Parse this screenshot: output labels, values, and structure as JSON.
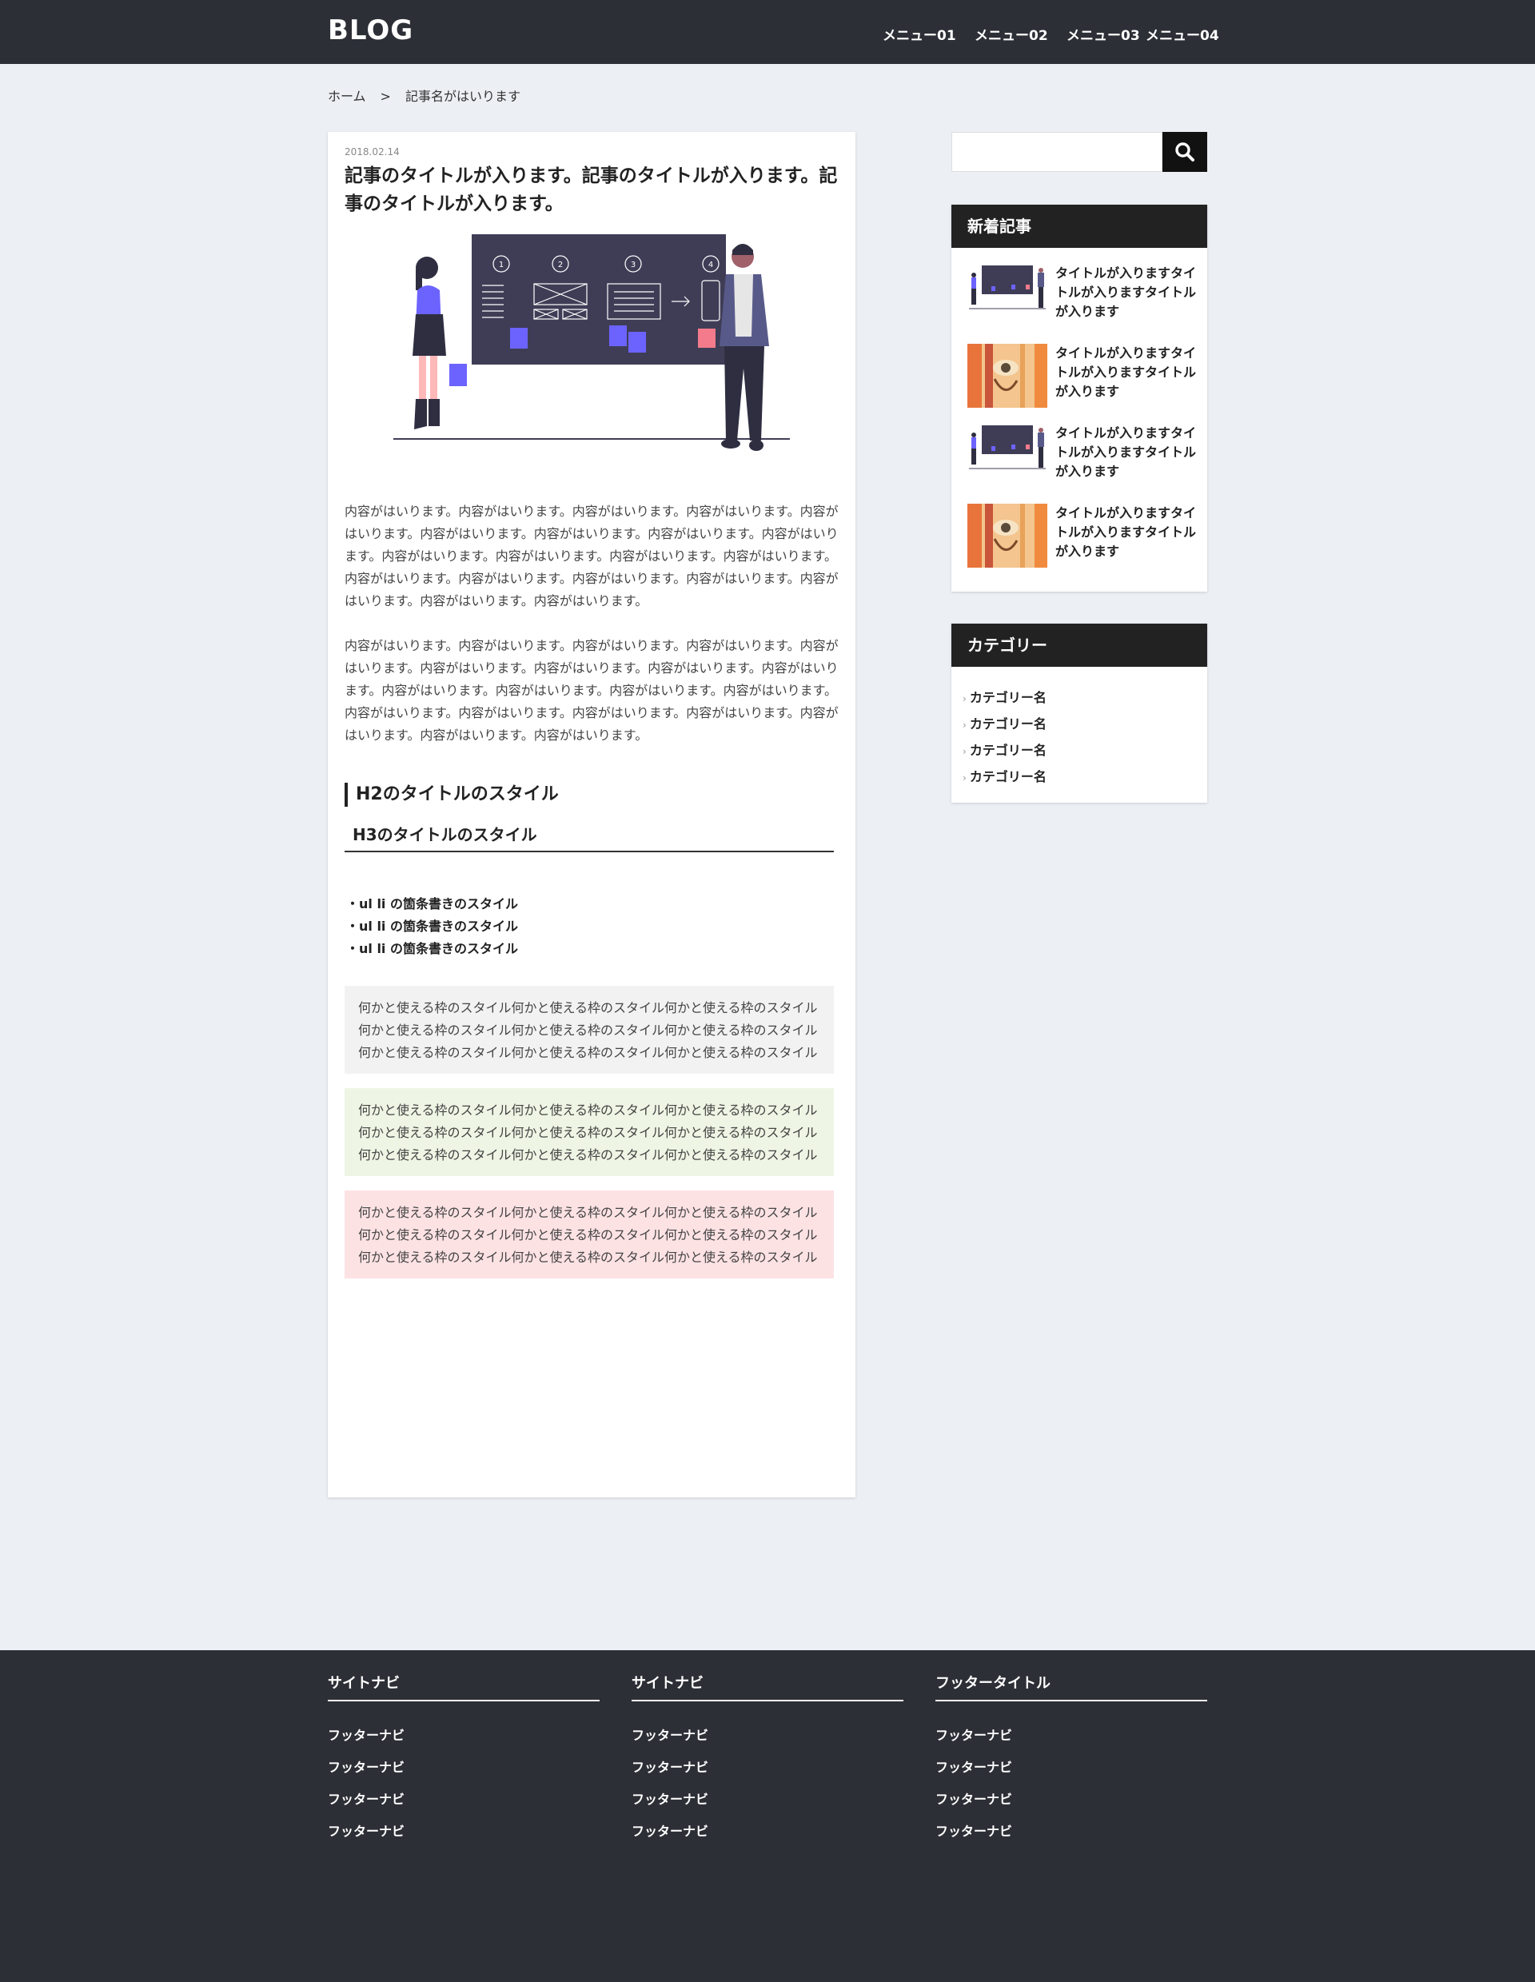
{
  "header": {
    "logo": "BLOG",
    "menu": [
      "メニュー01",
      "メニュー02",
      "メニュー03",
      "メニュー04"
    ]
  },
  "breadcrumb": {
    "home": "ホーム",
    "separator": ">",
    "current": "記事名がはいります"
  },
  "article": {
    "date": "2018.02.14",
    "title": "記事のタイトルが入ります。記事のタイトルが入ります。記事のタイトルが入ります。",
    "paragraphs": [
      "内容がはいります。内容がはいります。内容がはいります。内容がはいります。内容がはいります。内容がはいります。内容がはいります。内容がはいります。内容がはいります。内容がはいります。内容がはいります。内容がはいります。内容がはいります。内容がはいります。内容がはいります。内容がはいります。内容がはいります。内容がはいります。内容がはいります。内容がはいります。",
      "内容がはいります。内容がはいります。内容がはいります。内容がはいります。内容がはいります。内容がはいります。内容がはいります。内容がはいります。内容がはいります。内容がはいります。内容がはいります。内容がはいります。内容がはいります。内容がはいります。内容がはいります。内容がはいります。内容がはいります。内容がはいります。内容がはいります。内容がはいります。"
    ],
    "h2": "H2のタイトルのスタイル",
    "h3": "H3のタイトルのスタイル",
    "list": [
      "・ul li の箇条書きのスタイル",
      "・ul li の箇条書きのスタイル",
      "・ul li の箇条書きのスタイル"
    ],
    "boxes": [
      "何かと使える枠のスタイル何かと使える枠のスタイル何かと使える枠のスタイル何かと使える枠のスタイル何かと使える枠のスタイル何かと使える枠のスタイル何かと使える枠のスタイル何かと使える枠のスタイル何かと使える枠のスタイル",
      "何かと使える枠のスタイル何かと使える枠のスタイル何かと使える枠のスタイル何かと使える枠のスタイル何かと使える枠のスタイル何かと使える枠のスタイル何かと使える枠のスタイル何かと使える枠のスタイル何かと使える枠のスタイル",
      "何かと使える枠のスタイル何かと使える枠のスタイル何かと使える枠のスタイル何かと使える枠のスタイル何かと使える枠のスタイル何かと使える枠のスタイル何かと使える枠のスタイル何かと使える枠のスタイル何かと使える枠のスタイル"
    ],
    "hero_steps": [
      "1",
      "2",
      "3",
      "4"
    ]
  },
  "search": {
    "placeholder": "",
    "icon": "search-icon"
  },
  "recent": {
    "heading": "新着記事",
    "items": [
      {
        "title": "タイトルが入りますタイトルが入りますタイトルが入ります",
        "thumb": "presentation"
      },
      {
        "title": "タイトルが入りますタイトルが入りますタイトルが入ります",
        "thumb": "illustration"
      },
      {
        "title": "タイトルが入りますタイトルが入りますタイトルが入ります",
        "thumb": "presentation"
      },
      {
        "title": "タイトルが入りますタイトルが入りますタイトルが入ります",
        "thumb": "illustration"
      }
    ]
  },
  "category": {
    "heading": "カテゴリー",
    "items": [
      "カテゴリー名",
      "カテゴリー名",
      "カテゴリー名",
      "カテゴリー名"
    ]
  },
  "footer": {
    "columns": [
      {
        "title": "サイトナビ",
        "links": [
          "フッターナビ",
          "フッターナビ",
          "フッターナビ",
          "フッターナビ"
        ]
      },
      {
        "title": "サイトナビ",
        "links": [
          "フッターナビ",
          "フッターナビ",
          "フッターナビ",
          "フッターナビ"
        ]
      },
      {
        "title": "フッタータイトル",
        "links": [
          "フッターナビ",
          "フッターナビ",
          "フッターナビ",
          "フッターナビ"
        ]
      }
    ]
  },
  "colors": {
    "header_bg": "#2c2f36",
    "page_bg": "#eceff4",
    "accent_purple": "#6c63ff",
    "accent_pink": "#f47b8b"
  }
}
